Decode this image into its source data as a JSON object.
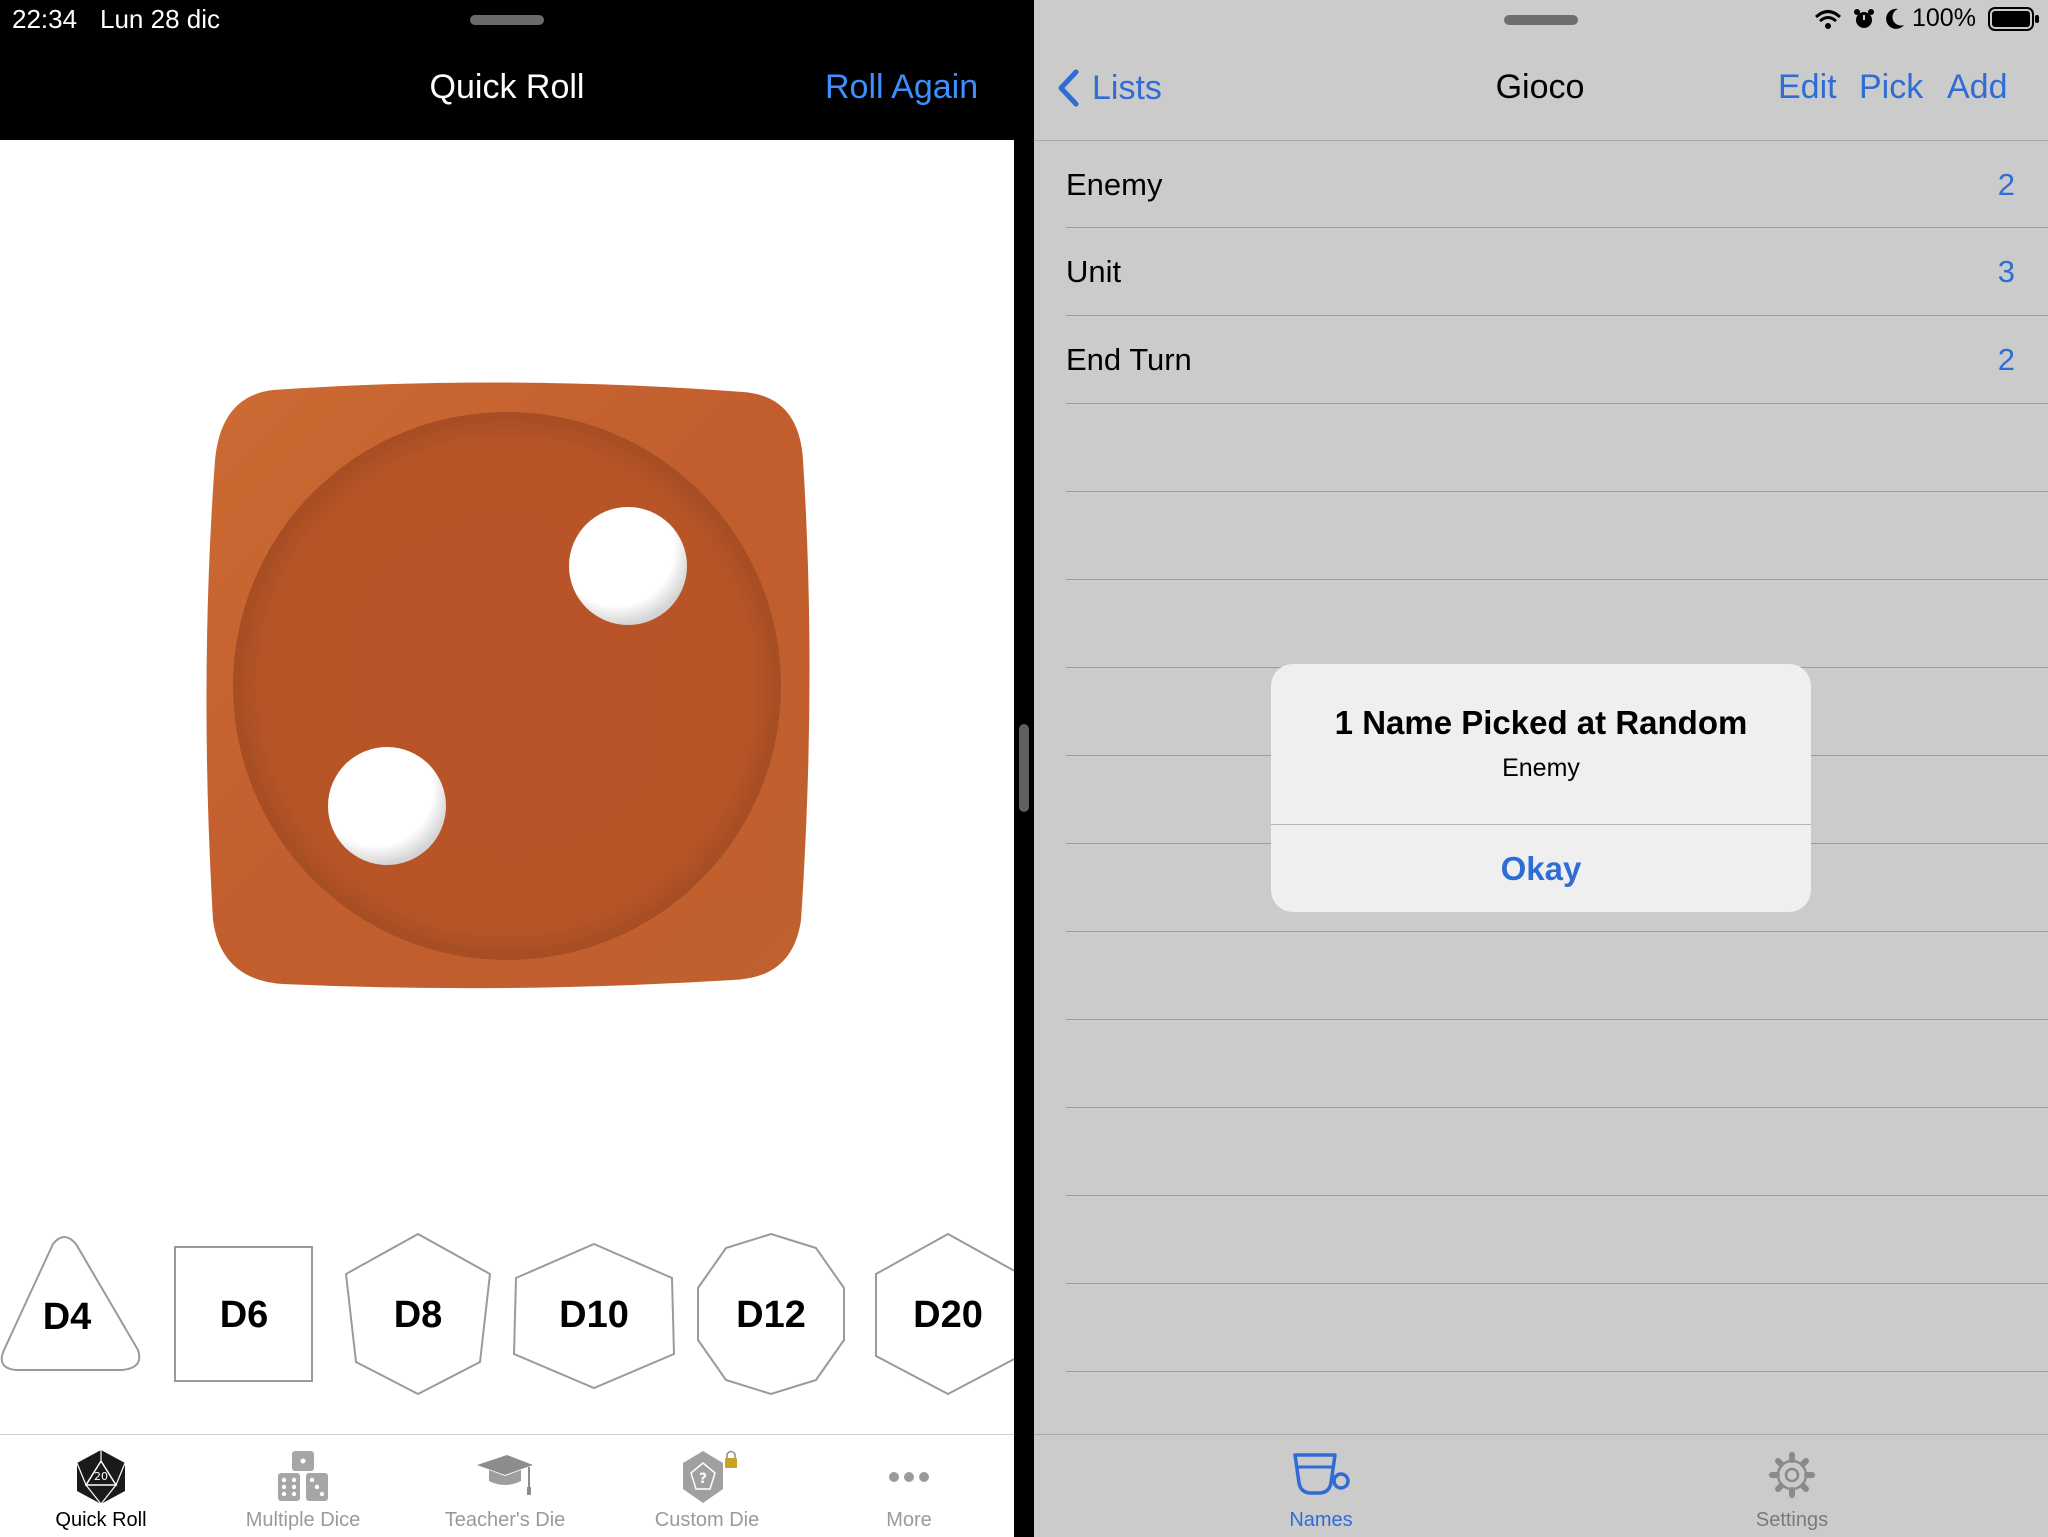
{
  "status_bar": {
    "time": "22:34",
    "date": "Lun 28 dic",
    "battery": "100%"
  },
  "left_app": {
    "title": "Quick Roll",
    "roll_again_label": "Roll Again",
    "die_result": 2,
    "die_color": "#b85527",
    "dice_buttons": [
      {
        "label": "D4"
      },
      {
        "label": "D6"
      },
      {
        "label": "D8"
      },
      {
        "label": "D10"
      },
      {
        "label": "D12"
      },
      {
        "label": "D20"
      }
    ],
    "tabs": [
      {
        "label": "Quick Roll",
        "icon": "d20-icon",
        "active": true
      },
      {
        "label": "Multiple Dice",
        "icon": "multiple-dice-icon"
      },
      {
        "label": "Teacher's Die",
        "icon": "graduation-cap-icon"
      },
      {
        "label": "Custom Die",
        "icon": "custom-die-lock-icon"
      },
      {
        "label": "More",
        "icon": "more-dots-icon"
      }
    ]
  },
  "right_app": {
    "back_label": "Lists",
    "title": "Gioco",
    "nav_buttons": {
      "edit": "Edit",
      "pick": "Pick",
      "add": "Add"
    },
    "rows": [
      {
        "name": "Enemy",
        "count": "2"
      },
      {
        "name": "Unit",
        "count": "3"
      },
      {
        "name": "End Turn",
        "count": "2"
      }
    ],
    "tabs": [
      {
        "label": "Names",
        "icon": "names-cup-icon",
        "active": true
      },
      {
        "label": "Settings",
        "icon": "gear-icon"
      }
    ],
    "accent_color": "#2f6dd5"
  },
  "alert": {
    "title": "1 Name Picked at Random",
    "message": "Enemy",
    "button": "Okay"
  }
}
